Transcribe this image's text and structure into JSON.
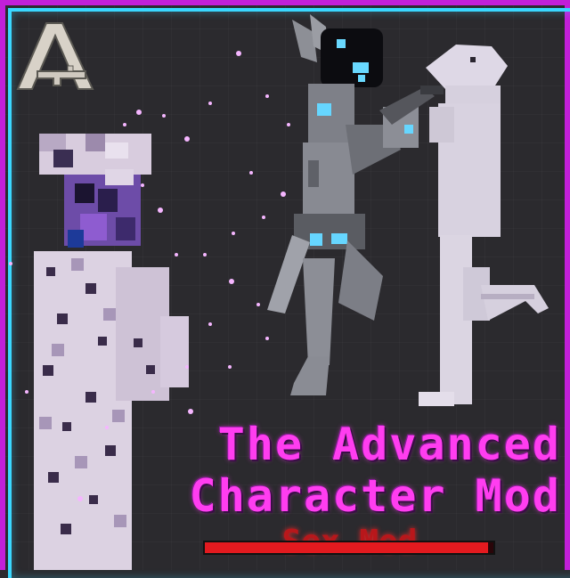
{
  "title_line1": "The Advanced",
  "title_line2": "Character Mod",
  "subtitle_obscured": "Sex Mod",
  "logo": {
    "icon": "letter-a-gun-logo"
  },
  "bar": {
    "fill_fraction": 0.98
  },
  "colors": {
    "frame_outer": "#c21fd8",
    "frame_inner": "#3ad8ff",
    "title": "#ff3df0",
    "bar": "#e31a1f",
    "background": "#2b2a2e"
  },
  "icons": [
    "letter-a-gun-logo",
    "pixel-robot-character",
    "pixel-lizard-character",
    "pixel-golem-character"
  ]
}
